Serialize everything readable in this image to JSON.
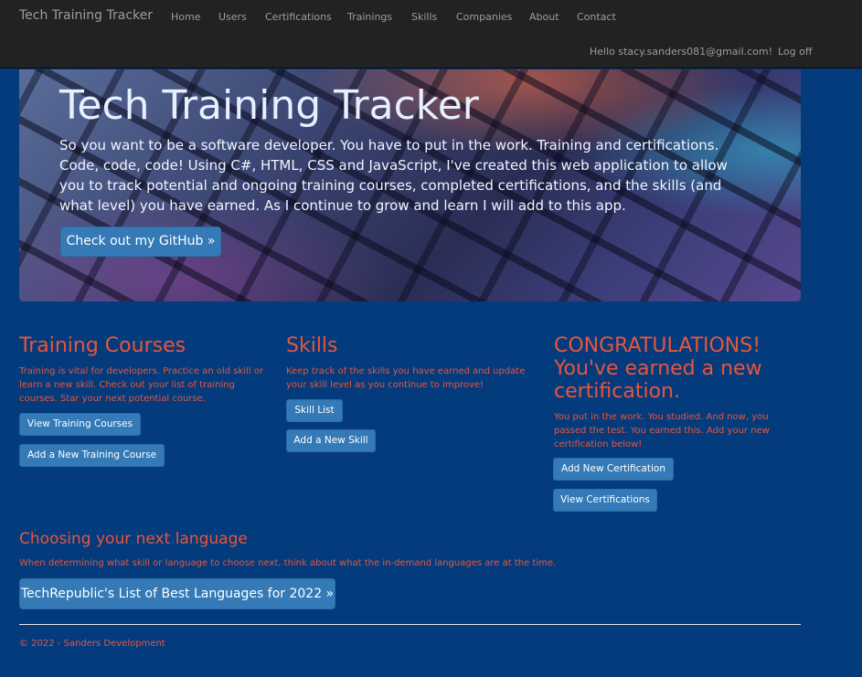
{
  "navbar": {
    "brand": "Tech Training Tracker",
    "links": [
      "Home",
      "Users",
      "Certifications",
      "Trainings",
      "Skills",
      "Companies",
      "About",
      "Contact"
    ],
    "greeting": "Hello stacy.sanders081@gmail.com!",
    "logoff": "Log off"
  },
  "hero": {
    "title": "Tech Training Tracker",
    "text": "So you want to be a software developer. You have to put in the work. Training and certifications. Code, code, code! Using C#, HTML, CSS and JavaScript, I've created this web application to allow you to track potential and ongoing training courses, completed certifications, and the skills (and what level) you have earned. As I continue to grow and learn I will add to this app.",
    "button": "Check out my GitHub »"
  },
  "columns": {
    "training": {
      "heading": "Training Courses",
      "text": "Training is vital for developers. Practice an old skill or learn a new skill. Check out your list of training courses. Star your next potential course.",
      "buttons": [
        "View Training Courses",
        "Add a New Training Course"
      ]
    },
    "skills": {
      "heading": "Skills",
      "text": "Keep track of the skills you have earned and update your skill level as you continue to improve!",
      "buttons": [
        "Skill List",
        "Add a New Skill"
      ]
    },
    "certs": {
      "heading": "CONGRATULATIONS! You've earned a new certification.",
      "text": "You put in the work. You studied. And now, you passed the test. You earned this. Add your new certification below!",
      "buttons": [
        "Add New Certification",
        "View Certifications"
      ]
    }
  },
  "language": {
    "heading": "Choosing your next language",
    "text": "When determining what skill or language to choose next, think about what the in-demand languages are at the time.",
    "button": "TechRepublic's List of Best Languages for 2022 »"
  },
  "footer": {
    "text": "© 2022 - Sanders Development"
  },
  "colors": {
    "background": "#033b7d",
    "navbar": "#222222",
    "accent_text": "#e8563a",
    "button": "#337ab7"
  }
}
